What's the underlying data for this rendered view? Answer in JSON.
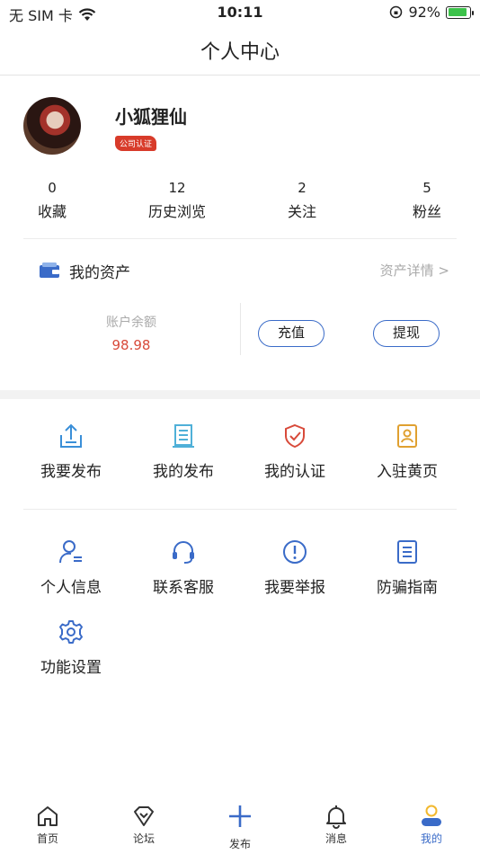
{
  "status_bar": {
    "carrier": "无 SIM 卡",
    "time": "10:11",
    "battery": "92%",
    "battery_level": 0.92
  },
  "nav": {
    "title": "个人中心"
  },
  "profile": {
    "name": "小狐狸仙",
    "badge": "公司认证"
  },
  "stats": [
    {
      "count": "0",
      "label": "收藏"
    },
    {
      "count": "12",
      "label": "历史浏览"
    },
    {
      "count": "2",
      "label": "关注"
    },
    {
      "count": "5",
      "label": "粉丝"
    }
  ],
  "assets": {
    "title": "我的资产",
    "detail_link": "资产详情 >",
    "balance_label": "账户余额",
    "balance_value": "98.98",
    "recharge_label": "充值",
    "withdraw_label": "提现"
  },
  "grid_row1": [
    {
      "label": "我要发布",
      "icon": "upload-icon"
    },
    {
      "label": "我的发布",
      "icon": "document-list-icon"
    },
    {
      "label": "我的认证",
      "icon": "shield-check-icon"
    },
    {
      "label": "入驻黄页",
      "icon": "id-card-icon"
    }
  ],
  "grid_row2": [
    {
      "label": "个人信息",
      "icon": "user-info-icon"
    },
    {
      "label": "联系客服",
      "icon": "headset-icon"
    },
    {
      "label": "我要举报",
      "icon": "alert-circle-icon"
    },
    {
      "label": "防骗指南",
      "icon": "guide-document-icon"
    }
  ],
  "grid_row3": [
    {
      "label": "功能设置",
      "icon": "gear-icon"
    }
  ],
  "tabbar": [
    {
      "label": "首页",
      "icon": "home-icon"
    },
    {
      "label": "论坛",
      "icon": "diamond-icon"
    },
    {
      "label": "发布",
      "icon": "plus-icon"
    },
    {
      "label": "消息",
      "icon": "bell-icon"
    },
    {
      "label": "我的",
      "icon": "user-icon",
      "active": true
    }
  ],
  "colors": {
    "accent": "#3a6bc8",
    "badge": "#d83b2a",
    "balance": "#d84a3a",
    "upload": "#3a8fd8",
    "list": "#4fb0d8",
    "shield": "#d84a3a",
    "idcard": "#e0a030"
  }
}
